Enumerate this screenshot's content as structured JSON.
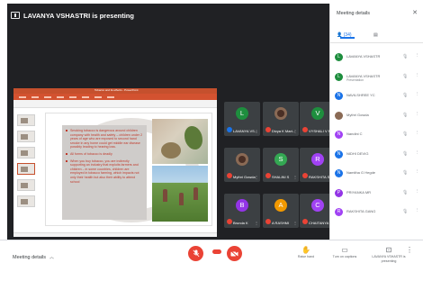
{
  "presenting_banner": "LAVANYA VSHASTRI is presenting",
  "presentation": {
    "window_title": "Tobacco and its effects - PowerPoint",
    "bullets": [
      "Smoking tobacco is dangerous around children company with health and safety – children under 2 years of age who are exposed to second hand smoke in any home could get middle ear disease possibly leading to hearing loss.",
      "All forms of tobacco is deadly",
      "When you buy tobacco, you are indirectly supporting an industry that exploits farmers and children – in some countries, children are employed in tobacco farming, which impacts not only their health but also their ability to attend school"
    ]
  },
  "tiles": [
    {
      "initial": "L",
      "name": "LAVANYA VS...",
      "color": "#1e8e3e",
      "photo": false,
      "mic": "on"
    },
    {
      "initial": "",
      "name": "Divya K Mart...",
      "color": "#8a6a55",
      "photo": true,
      "mic": "off"
    },
    {
      "initial": "V",
      "name": "VYSHALI V M",
      "color": "#1e8e3e",
      "photo": false,
      "mic": "off"
    },
    {
      "initial": "",
      "name": "Mythri Gowda",
      "color": "#8a6a55",
      "photo": true,
      "mic": "off"
    },
    {
      "initial": "S",
      "name": "SHALINI S",
      "color": "#34a853",
      "photo": false,
      "mic": "off"
    },
    {
      "initial": "R",
      "name": "RAKSHITA S...",
      "color": "#a142f4",
      "photo": false,
      "mic": "off"
    },
    {
      "initial": "B",
      "name": "Brunda K",
      "color": "#9334e6",
      "photo": false,
      "mic": "off"
    },
    {
      "initial": "A",
      "name": "A RASHMI",
      "color": "#f29900",
      "photo": false,
      "mic": "off"
    },
    {
      "initial": "C",
      "name": "CHAITANYA D",
      "color": "#a142f4",
      "photo": false,
      "mic": "off"
    }
  ],
  "panel": {
    "title": "Meeting details",
    "close_icon": "close-icon",
    "tabs": [
      {
        "label": "(34)",
        "icon": "people-icon"
      },
      {
        "label": "",
        "icon": "chat-icon"
      }
    ],
    "participants": [
      {
        "initial": "L",
        "name": "LAVANYA VSHASTR",
        "sub": "",
        "color": "#1e8e3e",
        "photo": false
      },
      {
        "initial": "L",
        "name": "LAVANYA VSHASTR",
        "sub": "Presentation",
        "color": "#1e8e3e",
        "photo": false
      },
      {
        "initial": "N",
        "name": "NAVILSHREE YC",
        "sub": "",
        "color": "#1a73e8",
        "photo": false
      },
      {
        "initial": "",
        "name": "Mythri Gowda",
        "sub": "",
        "color": "#8a6a55",
        "photo": true
      },
      {
        "initial": "N",
        "name": "Nandini C",
        "sub": "",
        "color": "#a142f4",
        "photo": false
      },
      {
        "initial": "N",
        "name": "NIDHI DEVIG",
        "sub": "",
        "color": "#1a73e8",
        "photo": false
      },
      {
        "initial": "N",
        "name": "Namitha G Hegde",
        "sub": "",
        "color": "#1a73e8",
        "photo": false
      },
      {
        "initial": "P",
        "name": "PRIYANKA MR",
        "sub": "",
        "color": "#9334e6",
        "photo": false
      },
      {
        "initial": "R",
        "name": "RAKSHITA GANG",
        "sub": "",
        "color": "#a142f4",
        "photo": false
      }
    ]
  },
  "controls": {
    "meeting_details": "Meeting details",
    "raise_hand": "Raise hand",
    "turn_on_captions": "Turn on captions",
    "presenting_label": "LAVANYA VSHASTR is presenting"
  }
}
